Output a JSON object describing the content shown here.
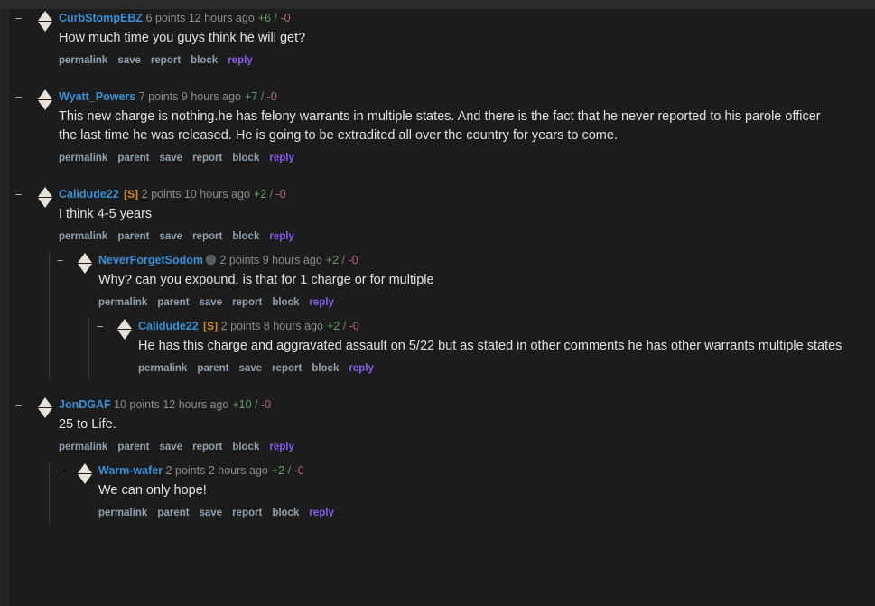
{
  "theme": {
    "background": "#1c1c1c",
    "top_strip": "#2b2b2b",
    "author_link": "#3a8fd4",
    "submitter_tag": "#d08b2a",
    "reply_link": "#8a5cf0",
    "muted_link": "#8ea0b0",
    "score_positive": "#5fa35f",
    "score_negative": "#b56a6a",
    "body_text": "#e2e2e2"
  },
  "labels": {
    "collapse": "−",
    "permalink": "permalink",
    "parent": "parent",
    "save": "save",
    "report": "report",
    "block": "block",
    "reply": "reply",
    "points": "points",
    "separator": "/",
    "submitter_tag": "[S]"
  },
  "comments": [
    {
      "id": "c1",
      "author": "CurbStompEBZ",
      "is_submitter": false,
      "has_flair": false,
      "points": "6 points",
      "age": "12 hours ago",
      "score_up": "+6",
      "score_down": "-0",
      "text": "How much time you guys think he will get?",
      "links": [
        "permalink",
        "save",
        "report",
        "block",
        "reply"
      ],
      "depth": 0
    },
    {
      "id": "c2",
      "author": "Wyatt_Powers",
      "is_submitter": false,
      "has_flair": false,
      "points": "7 points",
      "age": "9 hours ago",
      "score_up": "+7",
      "score_down": "-0",
      "text": "This new charge is nothing.he has felony warrants in multiple states. And there is the fact that he never reported to his parole officer the last time he was released. He is going to be extradited all over the country for years to come.",
      "links": [
        "permalink",
        "parent",
        "save",
        "report",
        "block",
        "reply"
      ],
      "depth": 0
    },
    {
      "id": "c3",
      "author": "Calidude22",
      "is_submitter": true,
      "has_flair": false,
      "points": "2 points",
      "age": "10 hours ago",
      "score_up": "+2",
      "score_down": "-0",
      "text": "I think 4-5 years",
      "links": [
        "permalink",
        "parent",
        "save",
        "report",
        "block",
        "reply"
      ],
      "depth": 0
    },
    {
      "id": "c3r1",
      "author": "NeverForgetSodom",
      "is_submitter": false,
      "has_flair": true,
      "points": "2 points",
      "age": "9 hours ago",
      "score_up": "+2",
      "score_down": "-0",
      "text": "Why? can you expound. is that for 1 charge or for multiple",
      "links": [
        "permalink",
        "parent",
        "save",
        "report",
        "block",
        "reply"
      ],
      "depth": 1
    },
    {
      "id": "c3r1r1",
      "author": "Calidude22",
      "is_submitter": true,
      "has_flair": false,
      "points": "2 points",
      "age": "8 hours ago",
      "score_up": "+2",
      "score_down": "-0",
      "text": "He has this charge and aggravated assault on 5/22 but as stated in other comments he has other warrants multiple states",
      "links": [
        "permalink",
        "parent",
        "save",
        "report",
        "block",
        "reply"
      ],
      "depth": 2
    },
    {
      "id": "c4",
      "author": "JonDGAF",
      "is_submitter": false,
      "has_flair": false,
      "points": "10 points",
      "age": "12 hours ago",
      "score_up": "+10",
      "score_down": "-0",
      "text": "25 to Life.",
      "links": [
        "permalink",
        "parent",
        "save",
        "report",
        "block",
        "reply"
      ],
      "depth": 0
    },
    {
      "id": "c4r1",
      "author": "Warm-wafer",
      "is_submitter": false,
      "has_flair": false,
      "points": "2 points",
      "age": "2 hours ago",
      "score_up": "+2",
      "score_down": "-0",
      "text": "We can only hope!",
      "links": [
        "permalink",
        "parent",
        "save",
        "report",
        "block",
        "reply"
      ],
      "depth": 1
    }
  ]
}
